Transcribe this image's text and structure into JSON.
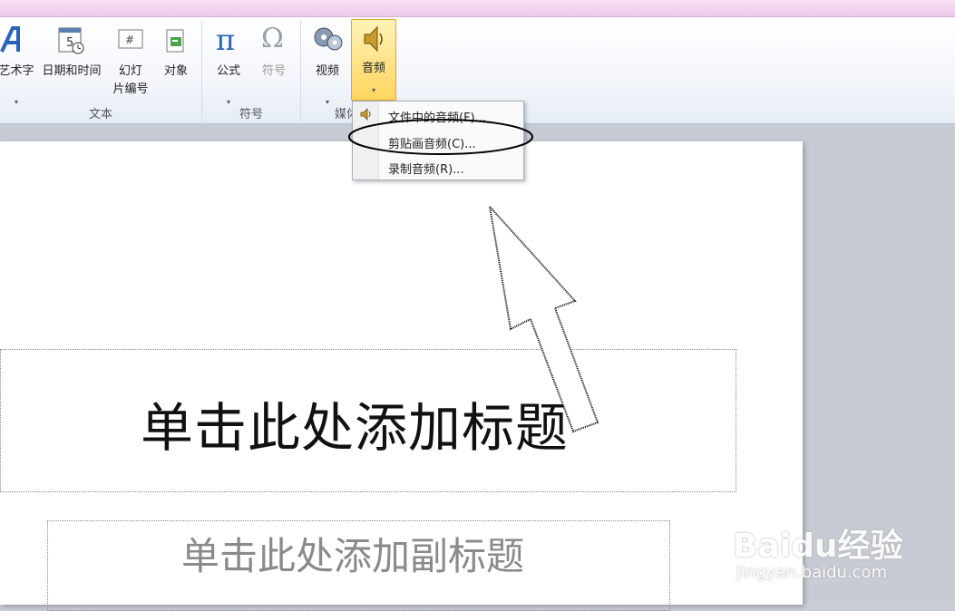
{
  "ribbon": {
    "groups": {
      "text": "文本",
      "symbols": "符号",
      "media": "媒体"
    },
    "buttons": {
      "wordart": "艺术字",
      "datetime": "日期和时间",
      "slide_number_line1": "幻灯",
      "slide_number_line2": "片编号",
      "object": "对象",
      "equation": "公式",
      "symbol": "符号",
      "video": "视频",
      "audio": "音频"
    }
  },
  "audio_menu": {
    "items": [
      {
        "label": "文件中的音频(F)..."
      },
      {
        "label": "剪贴画音频(C)..."
      },
      {
        "label": "录制音频(R)..."
      }
    ]
  },
  "slide": {
    "title_placeholder": "单击此处添加标题",
    "subtitle_placeholder": "单击此处添加副标题"
  },
  "watermark": {
    "brand": "Baidu经验",
    "url": "jingyan.baidu.com"
  }
}
